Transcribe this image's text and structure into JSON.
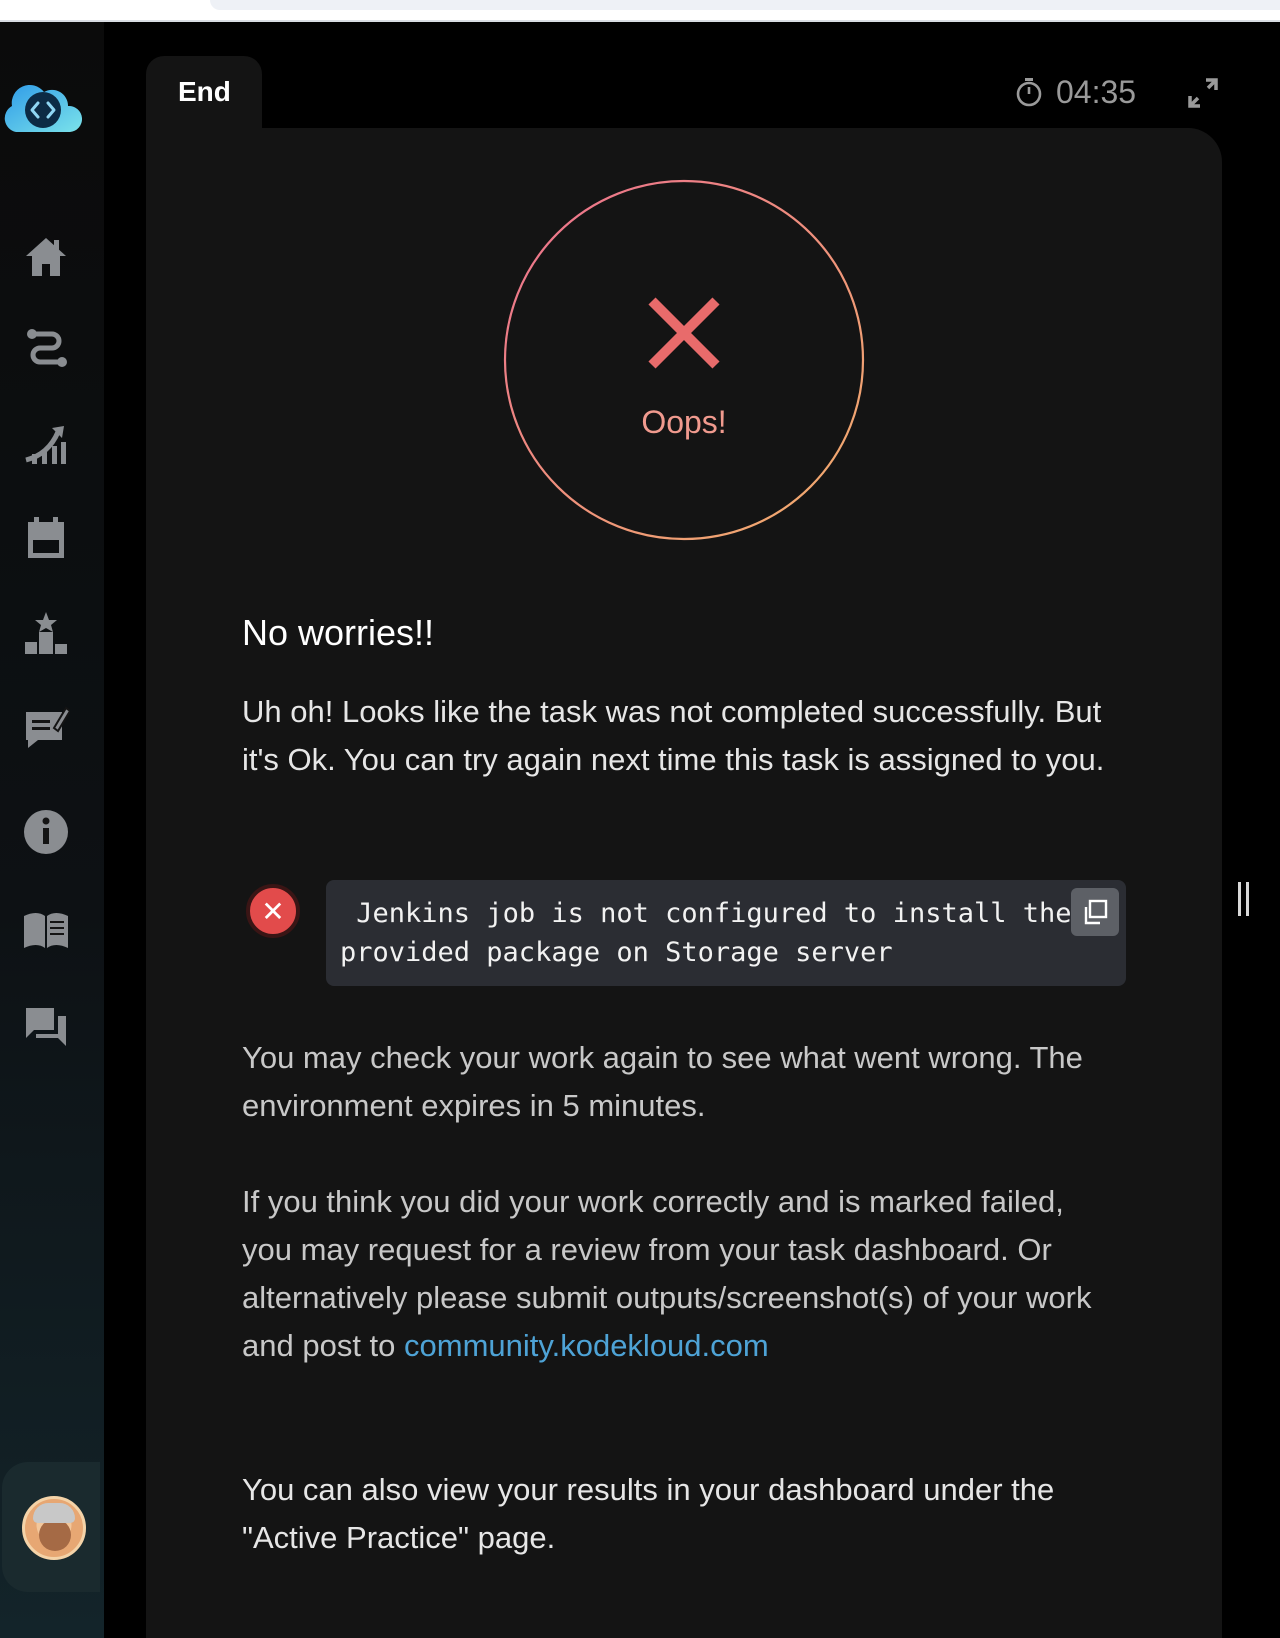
{
  "tab": {
    "label": "End"
  },
  "timer": {
    "value": "04:35"
  },
  "result": {
    "status": "Oops!"
  },
  "message": {
    "heading": "No worries!!",
    "intro": "Uh oh! Looks like the task was not completed successfully. But it's Ok. You can try again next time this task is assigned to you.",
    "error_text": " Jenkins job is not configured to install the provided package on Storage server",
    "check_again": "You may check your work again to see what went wrong. The environment expires in 5 minutes.",
    "review_text": "If you think you did your work correctly and is marked failed, you may request for a review from your task dashboard. Or alternatively please submit outputs/screenshot(s) of your work and post to",
    "community_link": "community.kodekloud.com",
    "dashboard_text": "You can also view your results in your dashboard under the \"Active Practice\" page."
  },
  "sidebar": {
    "items": [
      {
        "icon": "home-icon"
      },
      {
        "icon": "route-icon"
      },
      {
        "icon": "growth-chart-icon"
      },
      {
        "icon": "calendar-icon"
      },
      {
        "icon": "leaderboard-icon"
      },
      {
        "icon": "feedback-icon"
      },
      {
        "icon": "info-icon"
      },
      {
        "icon": "book-icon"
      },
      {
        "icon": "forum-icon"
      }
    ]
  },
  "colors": {
    "error": "#e24b4b",
    "link": "#4ea3d6",
    "oops_gradient_start": "#ec6f8f",
    "oops_gradient_end": "#f2b06b",
    "sidebar_edge": "#3b82c4"
  }
}
